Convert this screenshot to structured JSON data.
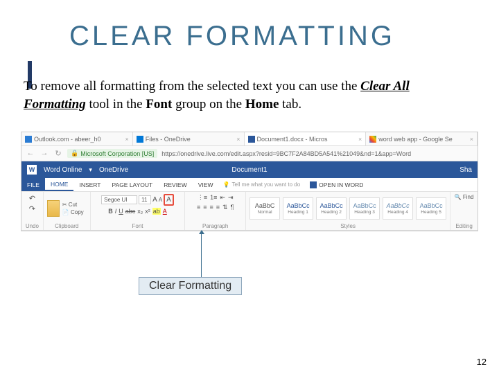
{
  "slide": {
    "title": "CLEAR FORMATTING",
    "body": {
      "pre": "To remove all formatting from the selected text you can use the ",
      "tool": "Clear All Formatting",
      "mid1": " tool in the ",
      "group": "Font",
      "mid2": " group on the ",
      "tab": "Home",
      "post": " tab."
    },
    "callout": "Clear Formatting",
    "page_number": "12"
  },
  "browser": {
    "tabs": [
      {
        "label": "Outlook.com - abeer_h0"
      },
      {
        "label": "Files - OneDrive"
      },
      {
        "label": "Document1.docx - Micros",
        "active": true
      },
      {
        "label": "word web app - Google Se"
      }
    ],
    "back": "←",
    "fwd": "→",
    "reload": "↻",
    "lock_label": "Microsoft Corporation [US]",
    "url": "https://onedrive.live.com/edit.aspx?resid=9BC7F2A84BD5A541%21049&nd=1&app=Word"
  },
  "word": {
    "app": "Word Online",
    "brand_glyph": "W",
    "onedrive": "OneDrive",
    "chevron": "▾",
    "doc": "Document1",
    "share": "Sha",
    "tabs": {
      "file": "FILE",
      "home": "HOME",
      "insert": "INSERT",
      "layout": "PAGE LAYOUT",
      "review": "REVIEW",
      "view": "VIEW",
      "tellme": "Tell me what you want to do",
      "open_in": "OPEN IN WORD"
    },
    "ribbon": {
      "undo": {
        "undo": "↶",
        "redo": "↷",
        "label": "Undo"
      },
      "clipboard": {
        "cut": "Cut",
        "copy": "Copy",
        "paste": "Paste",
        "label": "Clipboard"
      },
      "font": {
        "name": "Segoe UI",
        "size": "11",
        "grow": "A",
        "shrink": "A",
        "clear": "A",
        "bold": "B",
        "italic": "I",
        "under": "U",
        "strike": "abc",
        "sub": "x₂",
        "sup": "x²",
        "hl": "ab",
        "color": "A",
        "label": "Font"
      },
      "para": {
        "bul": "⋮≡",
        "num": "1≡",
        "out": "⇤",
        "in": "⇥",
        "al": "≡",
        "ac": "≡",
        "ar": "≡",
        "aj": "≡",
        "ls": "⇅",
        "ltr": "¶",
        "label": "Paragraph"
      },
      "styles": {
        "items": [
          {
            "preview": "AaBbC",
            "name": "Normal"
          },
          {
            "preview": "AaBbCc",
            "name": "Heading 1",
            "cls": "h1"
          },
          {
            "preview": "AaBbCc",
            "name": "Heading 2",
            "cls": "h2"
          },
          {
            "preview": "AaBbCc",
            "name": "Heading 3",
            "cls": "h3"
          },
          {
            "preview": "AaBbCc",
            "name": "Heading 4",
            "cls": "h4"
          },
          {
            "preview": "AaBbCc",
            "name": "Heading 5",
            "cls": "h5"
          }
        ],
        "label": "Styles"
      },
      "editing": {
        "find": "Find",
        "label": "Editing"
      }
    }
  }
}
